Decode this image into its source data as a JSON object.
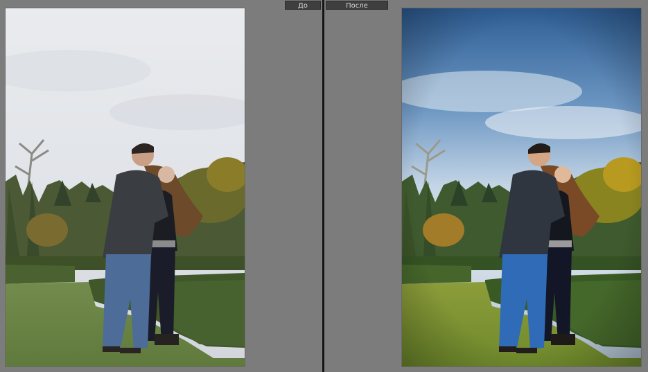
{
  "compare": {
    "before_label": "До",
    "after_label": "После"
  },
  "photos": {
    "before": {
      "subject": "couple-embracing-in-park",
      "tone": "flat-overcast"
    },
    "after": {
      "subject": "couple-embracing-in-park",
      "tone": "blue-sky-warm-grade"
    }
  },
  "colors": {
    "workspace": "#7c7c7c",
    "divider": "#151515",
    "tab_bg": "#3f3f3f",
    "tab_text": "#d6d6d6"
  }
}
